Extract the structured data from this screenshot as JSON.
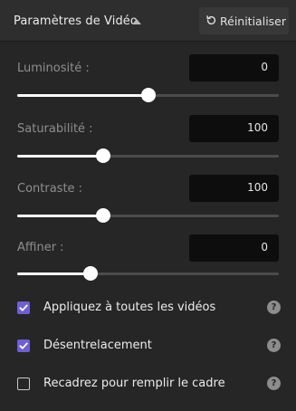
{
  "header": {
    "title": "Paramètres de Vidéo",
    "reset_label": "Réinitialiser"
  },
  "params": [
    {
      "label": "Luminosité :",
      "value": "0",
      "slider_fraction": 0.5
    },
    {
      "label": "Saturabilité :",
      "value": "100",
      "slider_fraction": 0.33
    },
    {
      "label": "Contraste :",
      "value": "100",
      "slider_fraction": 0.33
    },
    {
      "label": "Affiner :",
      "value": "0",
      "slider_fraction": 0.28
    }
  ],
  "options": [
    {
      "label": "Appliquez à toutes les vidéos",
      "checked": true
    },
    {
      "label": "Désentrelacement",
      "checked": true
    },
    {
      "label": "Recadrez pour remplir le cadre",
      "checked": false
    }
  ],
  "help_glyph": "?",
  "colors": {
    "accent": "#6e5fd6",
    "panel": "#262626",
    "header": "#2e2e2e",
    "value_box": "#0d0d0d"
  }
}
